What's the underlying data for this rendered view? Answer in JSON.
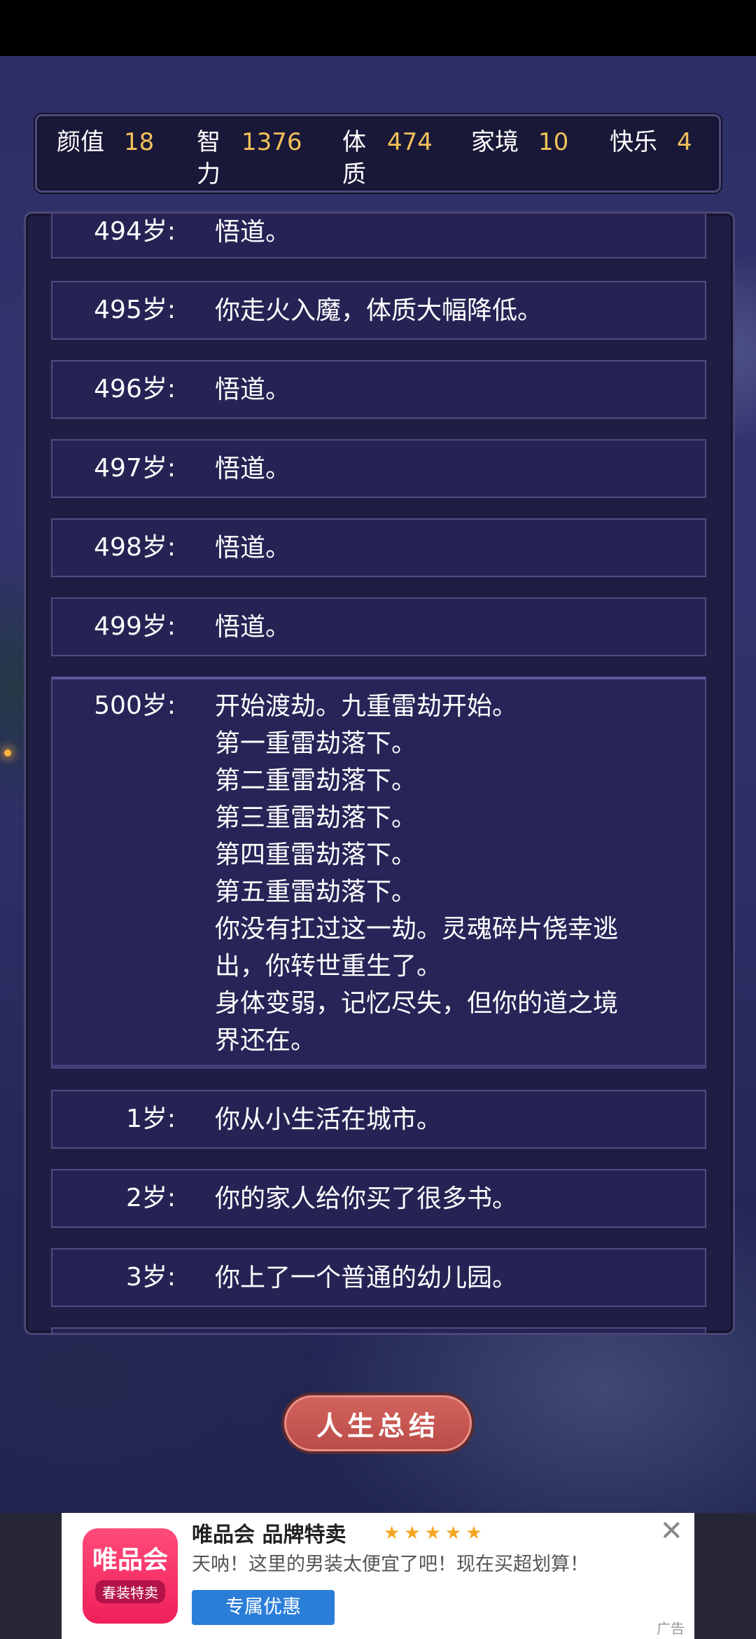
{
  "stats": [
    {
      "label": "颜值",
      "value": "18"
    },
    {
      "label": "智力",
      "value": "1376"
    },
    {
      "label": "体质",
      "value": "474"
    },
    {
      "label": "家境",
      "value": "10"
    },
    {
      "label": "快乐",
      "value": "4"
    }
  ],
  "timeline": [
    {
      "age": "494岁:",
      "lines": [
        "悟道。"
      ]
    },
    {
      "age": "495岁:",
      "lines": [
        "你走火入魔，体质大幅降低。"
      ]
    },
    {
      "age": "496岁:",
      "lines": [
        "悟道。"
      ]
    },
    {
      "age": "497岁:",
      "lines": [
        "悟道。"
      ]
    },
    {
      "age": "498岁:",
      "lines": [
        "悟道。"
      ]
    },
    {
      "age": "499岁:",
      "lines": [
        "悟道。"
      ]
    },
    {
      "age": "500岁:",
      "lines": [
        "开始渡劫。九重雷劫开始。",
        "第一重雷劫落下。",
        "第二重雷劫落下。",
        "第三重雷劫落下。",
        "第四重雷劫落下。",
        "第五重雷劫落下。",
        "你没有扛过这一劫。灵魂碎片侥幸逃",
        "出，你转世重生了。",
        "身体变弱，记忆尽失，但你的道之境",
        "界还在。"
      ]
    },
    {
      "age": "1岁:",
      "lines": [
        "你从小生活在城市。"
      ]
    },
    {
      "age": "2岁:",
      "lines": [
        "你的家人给你买了很多书。"
      ]
    },
    {
      "age": "3岁:",
      "lines": [
        "你上了一个普通的幼儿园。"
      ]
    }
  ],
  "summary_button": "人生总结",
  "ad": {
    "logo_text": "唯品会",
    "logo_badge": "春装特卖",
    "title": "唯品会 品牌特卖",
    "stars": "★★★★★",
    "description": "天呐！这里的男装太便宜了吧！现在买超划算！",
    "cta": "专属优惠",
    "close_icon": "close-icon",
    "tag": "广告"
  }
}
